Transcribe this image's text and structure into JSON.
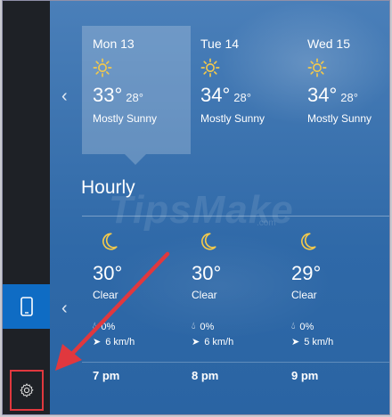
{
  "daily": [
    {
      "day": "Mon 13",
      "high": "33°",
      "low": "28°",
      "condition": "Mostly Sunny",
      "icon": "sun-icon"
    },
    {
      "day": "Tue 14",
      "high": "34°",
      "low": "28°",
      "condition": "Mostly Sunny",
      "icon": "sun-icon"
    },
    {
      "day": "Wed 15",
      "high": "34°",
      "low": "28°",
      "condition": "Mostly Sunny",
      "icon": "sun-icon"
    }
  ],
  "hourly": {
    "title": "Hourly",
    "items": [
      {
        "temp": "30°",
        "condition": "Clear",
        "precip": "0%",
        "wind": "6 km/h",
        "time": "7 pm",
        "icon": "moon-icon"
      },
      {
        "temp": "30°",
        "condition": "Clear",
        "precip": "0%",
        "wind": "6 km/h",
        "time": "8 pm",
        "icon": "moon-icon"
      },
      {
        "temp": "29°",
        "condition": "Clear",
        "precip": "0%",
        "wind": "5 km/h",
        "time": "9 pm",
        "icon": "moon-icon"
      }
    ]
  },
  "watermark": {
    "brand": "TipsMake",
    "suffix": ".com"
  },
  "colors": {
    "accent": "#0f6cc4",
    "highlight": "#e0383e",
    "sun": "#f2c94c"
  }
}
